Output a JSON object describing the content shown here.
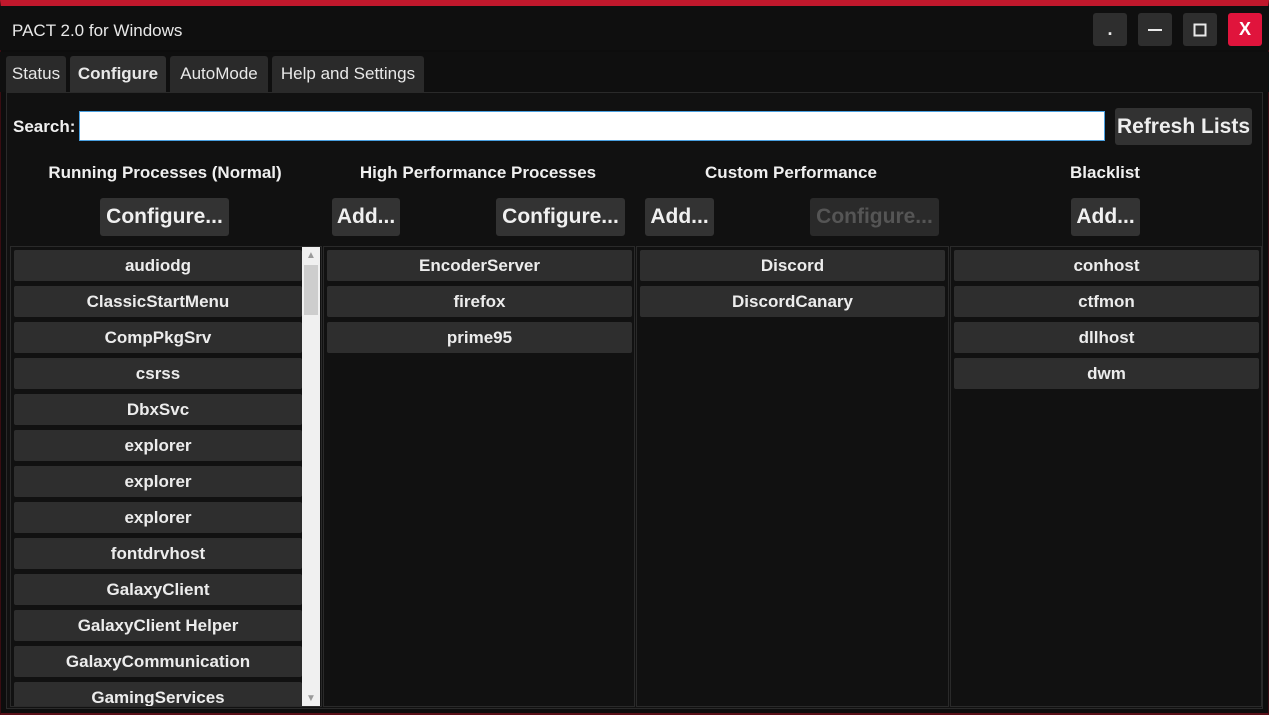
{
  "window": {
    "title": "PACT 2.0 for Windows",
    "accent_color": "#c0182c",
    "controls": {
      "dot_label": ".",
      "minimize_icon": "minimize-icon",
      "maximize_icon": "maximize-icon",
      "close_label": "X"
    }
  },
  "tabs": [
    {
      "label": "Status",
      "active": false
    },
    {
      "label": "Configure",
      "active": true
    },
    {
      "label": "AutoMode",
      "active": false
    },
    {
      "label": "Help and Settings",
      "active": false
    }
  ],
  "search": {
    "label": "Search:",
    "value": "",
    "refresh_label": "Refresh Lists"
  },
  "columns": {
    "normal": {
      "heading": "Running Processes (Normal)",
      "configure_label": "Configure...",
      "items": [
        "audiodg",
        "ClassicStartMenu",
        "CompPkgSrv",
        "csrss",
        "DbxSvc",
        "explorer",
        "explorer",
        "explorer",
        "fontdrvhost",
        "GalaxyClient",
        "GalaxyClient Helper",
        "GalaxyCommunication",
        "GamingServices"
      ]
    },
    "high": {
      "heading": "High Performance Processes",
      "add_label": "Add...",
      "configure_label": "Configure...",
      "items": [
        "EncoderServer",
        "firefox",
        "prime95"
      ]
    },
    "custom": {
      "heading": "Custom Performance",
      "add_label": "Add...",
      "configure_label": "Configure...",
      "configure_disabled": true,
      "items": [
        "Discord",
        "DiscordCanary"
      ]
    },
    "blacklist": {
      "heading": "Blacklist",
      "add_label": "Add...",
      "items": [
        "conhost",
        "ctfmon",
        "dllhost",
        "dwm"
      ]
    }
  }
}
